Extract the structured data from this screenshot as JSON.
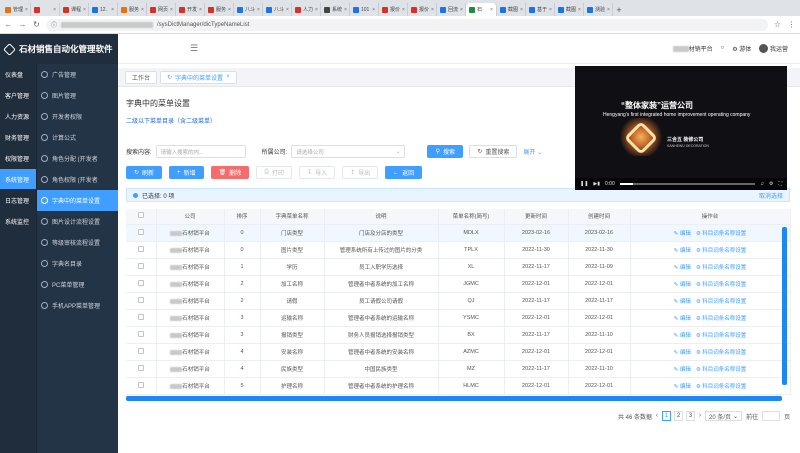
{
  "browser": {
    "tabs": [
      {
        "label": "管理",
        "color": "#e8710a"
      },
      {
        "label": "",
        "color": "#d93025"
      },
      {
        "label": "课程",
        "color": "#d93025"
      },
      {
        "label": "12.",
        "color": "#1a73e8"
      },
      {
        "label": "服务",
        "color": "#e8710a"
      },
      {
        "label": "网页",
        "color": "#d93025"
      },
      {
        "label": "开发",
        "color": "#d93025"
      },
      {
        "label": "服务",
        "color": "#d93025"
      },
      {
        "label": "八斗",
        "color": "#1a73e8"
      },
      {
        "label": "八斗",
        "color": "#1a73e8"
      },
      {
        "label": "人力",
        "color": "#d93025"
      },
      {
        "label": "系统",
        "color": "#444444"
      },
      {
        "label": "101",
        "color": "#1a73e8"
      },
      {
        "label": "报价",
        "color": "#d93025"
      },
      {
        "label": "报价",
        "color": "#d93025"
      },
      {
        "label": "回流",
        "color": "#1a73e8"
      },
      {
        "label": "石",
        "color": "#1e8e3e"
      },
      {
        "label": "截图",
        "color": "#1a73e8"
      },
      {
        "label": "基于",
        "color": "#1a73e8"
      },
      {
        "label": "截图",
        "color": "#1a73e8"
      },
      {
        "label": "测验",
        "color": "#1a73e8"
      }
    ],
    "active_tab_index": 16,
    "url": "/sysDictManager/dicTypeNameList"
  },
  "app": {
    "brand": "石材销售自动化管理软件",
    "top_menu": [
      "仪表盘",
      "客户管理",
      "人力资源",
      "财务管理",
      "权限管理",
      "系统管理",
      "日志管理",
      "系统监控"
    ],
    "top_menu_active": 5,
    "side_menu": [
      "广告管理",
      "图片管理",
      "开发者权限",
      "计算公式",
      "角色分配 (开发者",
      "角色权限 (开发者",
      "字典中的菜单设置",
      "图片设计流程设置",
      "等级审核流程设置",
      "字典名目录",
      "PC菜单管理",
      "手机APP菜单管理"
    ],
    "side_menu_active": 6,
    "header": {
      "company": "材销平台",
      "theme": "游体",
      "user": "我运营"
    }
  },
  "page_tabs": [
    "工作台",
    "字典中的菜单设置"
  ],
  "page_tabs_active": 1,
  "video_ad": {
    "title": "“整体家装”运营公司",
    "subtitle": "Hengyang's first integrated home improvement operating company",
    "brand_cn": "三合五 装修公司",
    "brand_en": "SANHEWU DECORATION",
    "time": "0:00"
  },
  "content": {
    "title": "字典中的菜单设置",
    "subtitle_link": "二级以下菜单目录（含二级菜单）",
    "search": {
      "label": "搜索内容:",
      "placeholder": "请输入搜索的内...",
      "company_label": "所属公司:",
      "company_placeholder": "请选择公司",
      "search_btn": "搜索",
      "reset_btn": "重置搜索",
      "expand": "展开"
    },
    "toolbar": [
      "刷新",
      "新增",
      "删除",
      "打印",
      "导入",
      "导出",
      "返回"
    ],
    "selection": {
      "text": "已选择: 0 项",
      "clear": "取消选择"
    },
    "columns": [
      "",
      "公司",
      "排序",
      "字典菜单名称",
      "说明",
      "菜单名称(简写)",
      "更新时间",
      "创建时间",
      "操作台"
    ],
    "rows": [
      [
        "石材销平台",
        "0",
        "门店类型",
        "门店及分店的类型",
        "MDLX",
        "2023-02-16",
        "2023-02-16"
      ],
      [
        "石材销平台",
        "0",
        "图片类型",
        "管理系统所有上传过的图片的分类",
        "TPLX",
        "2022-11-30",
        "2022-11-30"
      ],
      [
        "石材销平台",
        "1",
        "学历",
        "员工入职学历选择",
        "XL",
        "2022-11-17",
        "2022-11-09"
      ],
      [
        "石材销平台",
        "2",
        "加工名称",
        "管理者中者系统的加工名称",
        "JGMC",
        "2022-12-01",
        "2022-12-01"
      ],
      [
        "石材销平台",
        "2",
        "请假",
        "员工请假公司请假",
        "QJ",
        "2022-11-17",
        "2022-11-17"
      ],
      [
        "石材销平台",
        "3",
        "运输名称",
        "管理者中者系统的运输名称",
        "YSMC",
        "2022-12-01",
        "2022-12-01"
      ],
      [
        "石材销平台",
        "3",
        "报销类型",
        "财务人员报销选择报销类型",
        "BX",
        "2022-11-17",
        "2022-11-10"
      ],
      [
        "石材销平台",
        "4",
        "安装名称",
        "管理者中者系统的安装名称",
        "AZMC",
        "2022-12-01",
        "2022-12-01"
      ],
      [
        "石材销平台",
        "4",
        "民族类型",
        "中国民族类型",
        "MZ",
        "2022-11-17",
        "2022-11-10"
      ],
      [
        "石材销平台",
        "5",
        "护理名称",
        "管理者中者系统的护理名称",
        "HLMC",
        "2022-12-01",
        "2022-12-01"
      ]
    ],
    "row_actions": {
      "edit": "编辑",
      "setup": "科目词条名称设置"
    },
    "pagination": {
      "total": "共 46 条数据",
      "pages": [
        "1",
        "2",
        "3"
      ],
      "current": "1",
      "page_size": "20 条/页",
      "goto": "前往",
      "suffix": "页"
    }
  }
}
